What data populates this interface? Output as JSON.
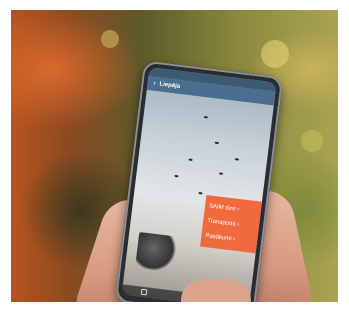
{
  "photo": {
    "description_colors": {
      "orange": "#d86a2a",
      "green": "#7d8b3a"
    }
  },
  "app": {
    "title": "Liepāja",
    "status_left": "",
    "status_right": "",
    "menu": [
      {
        "label": "SAIM tūre ›"
      },
      {
        "label": "Transports ›"
      },
      {
        "label": "Pasākumi ›"
      }
    ],
    "accent": "#f06a3e",
    "header_color": "#4a6f8e"
  }
}
